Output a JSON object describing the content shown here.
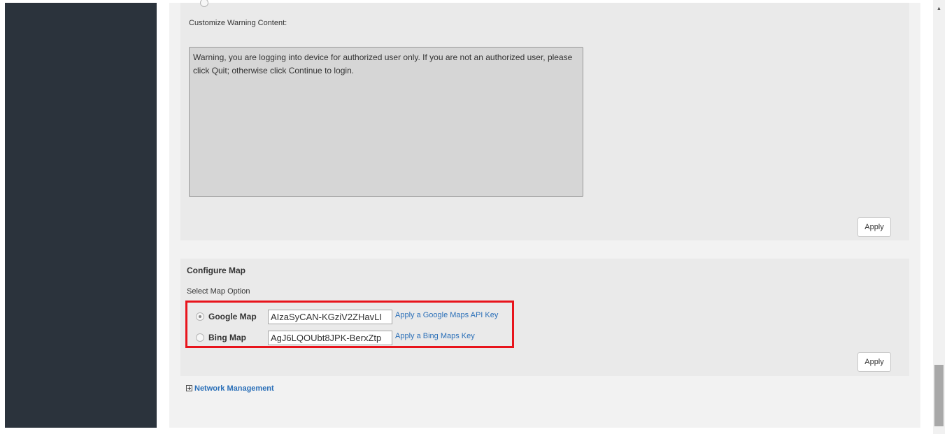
{
  "warning": {
    "label": "Customize Warning Content:",
    "content": "Warning, you are logging into device for authorized user only. If you are not an authorized user, please click Quit; otherwise click Continue to login.",
    "apply_label": "Apply"
  },
  "map": {
    "title": "Configure Map",
    "subtitle": "Select Map Option",
    "options": [
      {
        "label": "Google Map",
        "selected": true,
        "key_value": "AIzaSyCAN-KGziV2ZHavLI",
        "link_label": "Apply a Google Maps API Key"
      },
      {
        "label": "Bing Map",
        "selected": false,
        "key_value": "AgJ6LQOUbt8JPK-BerxZtp",
        "link_label": "Apply a Bing Maps Key"
      }
    ],
    "apply_label": "Apply",
    "highlight_color": "#e8141c"
  },
  "network": {
    "label": "Network Management",
    "expand_icon": "plus-square-icon"
  },
  "colors": {
    "sidebar": "#2b333c",
    "content_bg": "#f2f2f2",
    "panel_bg": "#eaeaea",
    "link": "#2a6fb8"
  }
}
